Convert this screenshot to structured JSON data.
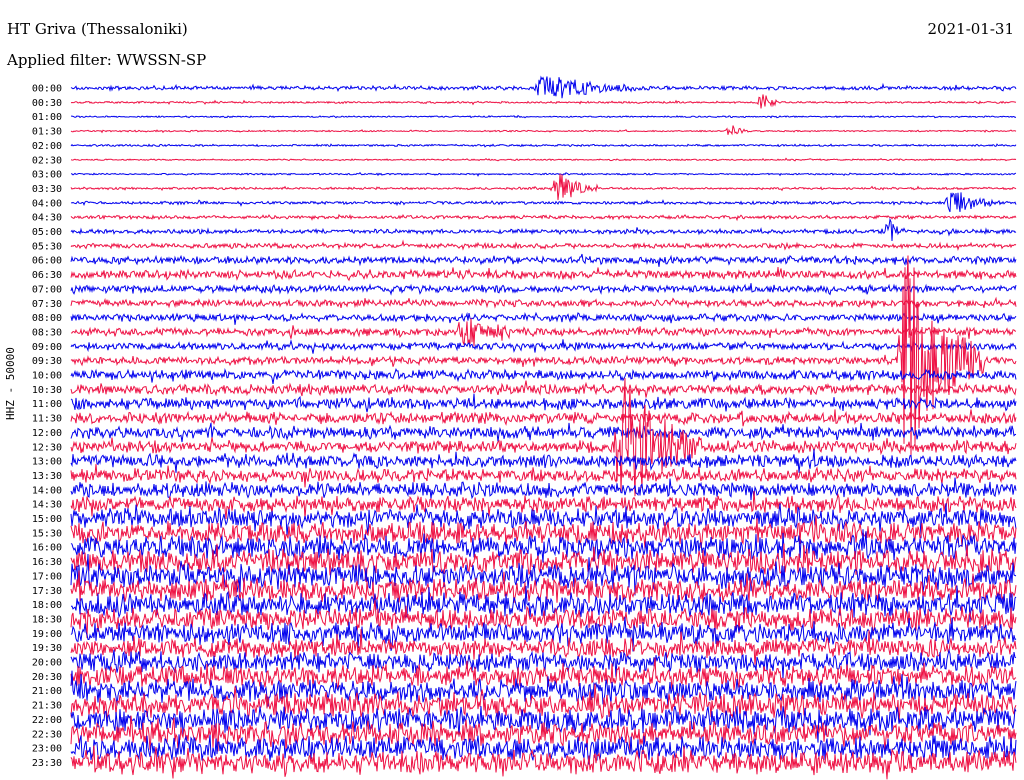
{
  "header": {
    "station": "HT Griva (Thessaloniki)",
    "date": "2021-01-31",
    "filter": "Applied filter: WWSSN-SP"
  },
  "chart_data": {
    "type": "line",
    "ylabel": "HHZ - 50000",
    "colors": [
      "#0000ee",
      "#ee1144"
    ],
    "rows": [
      "00:00",
      "00:30",
      "01:00",
      "01:30",
      "02:00",
      "02:30",
      "03:00",
      "03:30",
      "04:00",
      "04:30",
      "05:00",
      "05:30",
      "06:00",
      "06:30",
      "07:00",
      "07:30",
      "08:00",
      "08:30",
      "09:00",
      "09:30",
      "10:00",
      "10:30",
      "11:00",
      "11:30",
      "12:00",
      "12:30",
      "13:00",
      "13:30",
      "14:00",
      "14:30",
      "15:00",
      "15:30",
      "16:00",
      "16:30",
      "17:00",
      "17:30",
      "18:00",
      "18:30",
      "19:00",
      "19:30",
      "20:00",
      "20:30",
      "21:00",
      "21:30",
      "22:00",
      "22:30",
      "23:00",
      "23:30"
    ],
    "noise_level": [
      1.5,
      0.8,
      0.6,
      0.6,
      0.8,
      0.6,
      0.7,
      0.9,
      1.2,
      1.4,
      1.8,
      2.0,
      3.2,
      3.5,
      3.0,
      2.8,
      3.0,
      3.2,
      3.0,
      3.2,
      4.0,
      4.2,
      4.5,
      4.5,
      4.8,
      5.0,
      5.2,
      5.5,
      6.0,
      6.5,
      8.0,
      9.0,
      9.5,
      10.0,
      10.0,
      9.5,
      9.5,
      9.0,
      8.5,
      8.0,
      8.0,
      8.5,
      9.5,
      10.0,
      10.0,
      9.5,
      9.5,
      9.5
    ],
    "events": [
      {
        "row": 0,
        "minute": 15,
        "amplitude": 14,
        "duration": 3
      },
      {
        "row": 1,
        "minute": 22,
        "amplitude": 10,
        "duration": 0.5
      },
      {
        "row": 3,
        "minute": 21,
        "amplitude": 6,
        "duration": 0.5
      },
      {
        "row": 7,
        "minute": 15.5,
        "amplitude": 16,
        "duration": 1.2
      },
      {
        "row": 8,
        "minute": 28,
        "amplitude": 12,
        "duration": 1.5
      },
      {
        "row": 10,
        "minute": 26,
        "amplitude": 10,
        "duration": 0.5
      },
      {
        "row": 17,
        "minute": 12.5,
        "amplitude": 14,
        "duration": 1.5
      },
      {
        "row": 19,
        "minute": 26.5,
        "amplitude": 110,
        "duration": 2.5
      },
      {
        "row": 25,
        "minute": 17.5,
        "amplitude": 70,
        "duration": 2.5
      }
    ]
  }
}
